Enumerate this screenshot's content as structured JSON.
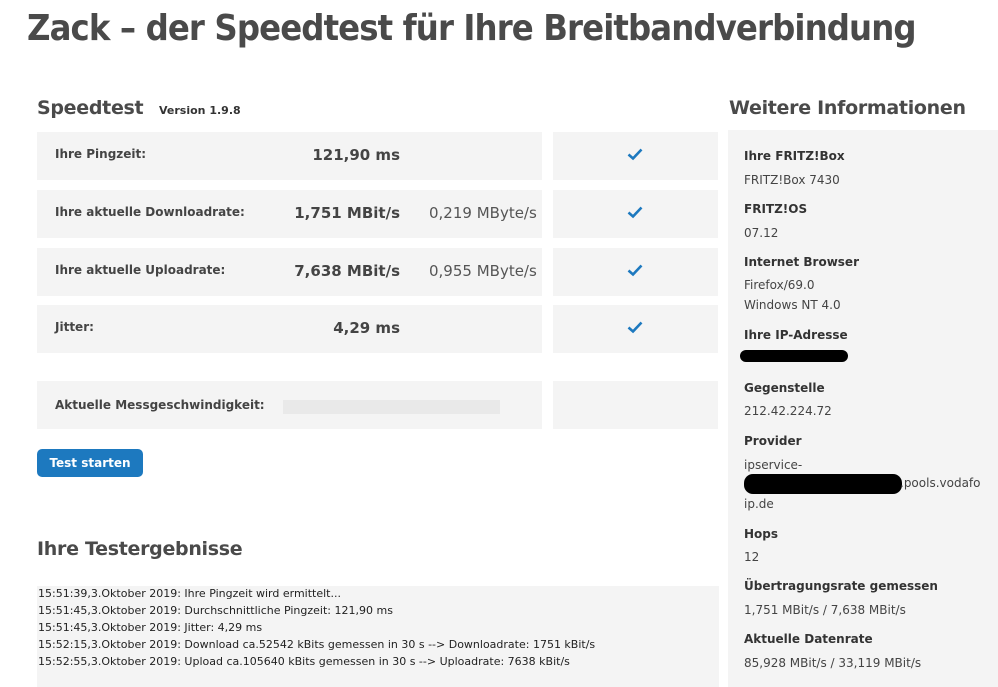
{
  "page_title": "Zack – der Speedtest für Ihre Breitbandverbindung",
  "speedtest": {
    "heading": "Speedtest",
    "version": "Version 1.9.8",
    "rows": [
      {
        "label": "Ihre Pingzeit:",
        "value": "121,90 ms",
        "value2": ""
      },
      {
        "label": "Ihre aktuelle Downloadrate:",
        "value": "1,751 MBit/s",
        "value2": "0,219 MByte/s"
      },
      {
        "label": "Ihre aktuelle Uploadrate:",
        "value": "7,638 MBit/s",
        "value2": "0,955 MByte/s"
      },
      {
        "label": "Jitter:",
        "value": "4,29 ms",
        "value2": ""
      }
    ],
    "current_speed_label": "Aktuelle Messgeschwindigkeit:",
    "current_speed_progress": 0,
    "start_button": "Test starten"
  },
  "results": {
    "heading": "Ihre Testergebnisse",
    "log": [
      "15:51:39,3.Oktober 2019: Ihre Pingzeit wird ermittelt...",
      "15:51:45,3.Oktober 2019: Durchschnittliche Pingzeit: 121,90 ms",
      "15:51:45,3.Oktober 2019: Jitter: 4,29 ms",
      "15:52:15,3.Oktober 2019: Download ca.52542 kBits gemessen in 30 s --> Downloadrate: 1751 kBit/s",
      "15:52:55,3.Oktober 2019: Upload ca.105640 kBits gemessen in 30 s --> Uploadrate: 7638 kBit/s"
    ]
  },
  "info": {
    "heading": "Weitere Informationen",
    "fritzbox_label": "Ihre FRITZ!Box",
    "fritzbox_value": "FRITZ!Box 7430",
    "fritzos_label": "FRITZ!OS",
    "fritzos_value": "07.12",
    "browser_label": "Internet Browser",
    "browser_value1": "Firefox/69.0",
    "browser_value2": "Windows NT 4.0",
    "ip_label": "Ihre IP-Adresse",
    "peer_label": "Gegenstelle",
    "peer_value": "212.42.224.72",
    "provider_label": "Provider",
    "provider_value1": "ipservice-",
    "provider_value2": ".pools.vodafo",
    "provider_value3": "ip.de",
    "hops_label": "Hops",
    "hops_value": "12",
    "measured_label": "Übertragungsrate gemessen",
    "measured_value": "1,751 MBit/s / 7,638 MBit/s",
    "datarate_label": "Aktuelle Datenrate",
    "datarate_value": "85,928 MBit/s / 33,119 MBit/s"
  },
  "colors": {
    "accent": "#1d79bf",
    "check": "#1d79bf",
    "panel_bg": "#f4f4f4"
  }
}
